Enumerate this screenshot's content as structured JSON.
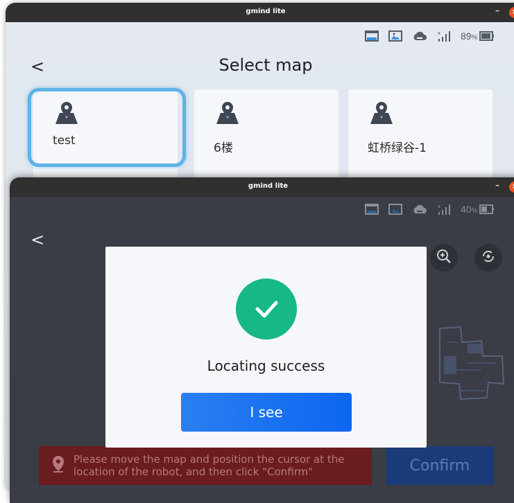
{
  "window_top": {
    "title": "gmind lite",
    "minimize_label": "–",
    "close_label": "×",
    "status": {
      "battery_pct": "89",
      "pct_sign": "%"
    },
    "page_title": "Select map",
    "back_label": "<",
    "maps": [
      {
        "name": "test",
        "selected": true
      },
      {
        "name": "6楼",
        "selected": false
      },
      {
        "name": "虹桥绿谷-1",
        "selected": false
      }
    ]
  },
  "window_bottom": {
    "title": "gmind lite",
    "minimize_label": "–",
    "close_label": "×",
    "status": {
      "battery_pct": "40",
      "pct_sign": "%"
    },
    "back_label": "<",
    "hint_text": "Please move the map and position the cursor at the location of the robot, and then click \"Confirm\"",
    "confirm_label": "Confirm",
    "dialog": {
      "message": "Locating success",
      "button_label": "I see"
    }
  },
  "colors": {
    "accent": "#5fb3e5",
    "success": "#15b886",
    "primary_button": "#0d66f0",
    "hint_bg": "#6a1c20",
    "confirm_bg": "#1a3b78",
    "titlebar": "#303030"
  }
}
